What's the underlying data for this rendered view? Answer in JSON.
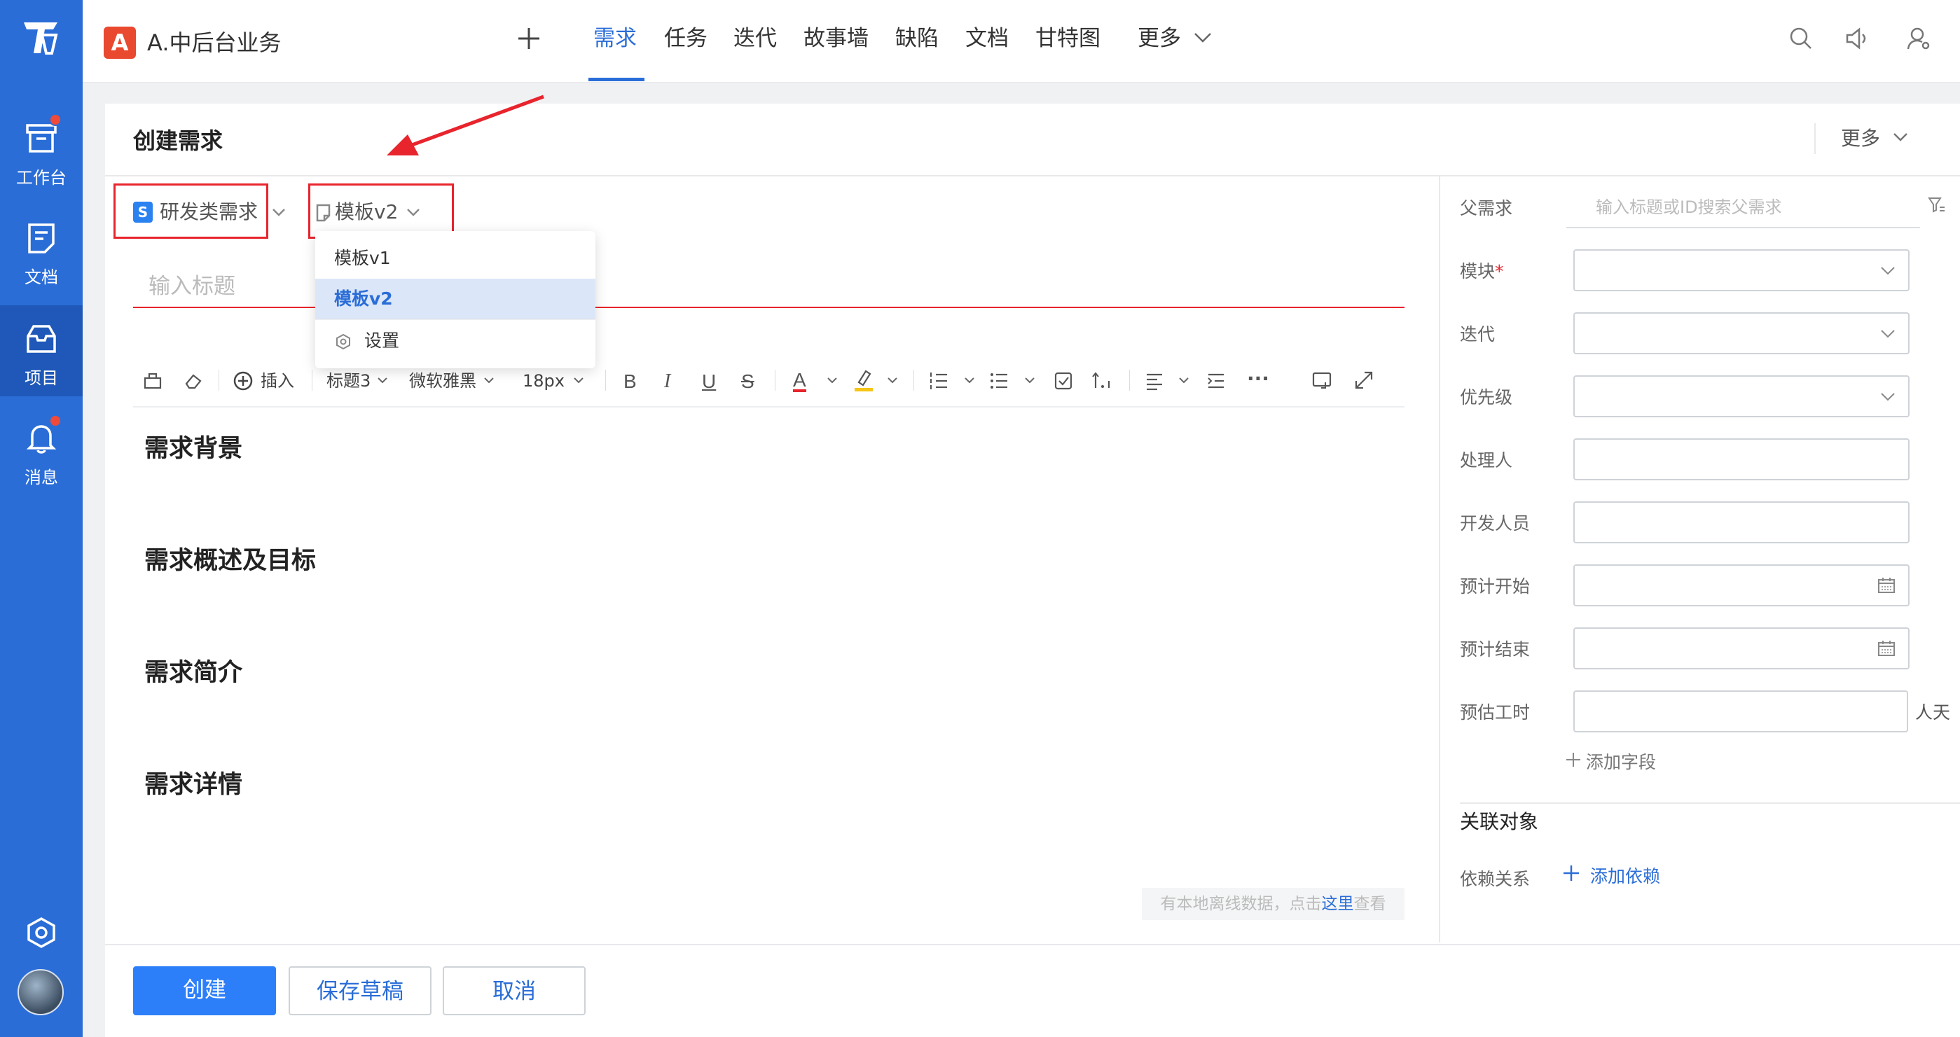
{
  "sidebar": {
    "items": [
      {
        "label": "工作台",
        "icon": "workbench-icon",
        "badge": true
      },
      {
        "label": "文档",
        "icon": "document-icon",
        "badge": false
      },
      {
        "label": "项目",
        "icon": "project-icon",
        "badge": false,
        "active": true
      },
      {
        "label": "消息",
        "icon": "bell-icon",
        "badge": true
      }
    ],
    "bottom_icons": [
      "settings-icon",
      "avatar"
    ]
  },
  "topbar": {
    "project_badge": "A",
    "project_name": "A.中后台业务",
    "add_icon": "plus-icon",
    "tabs": [
      {
        "label": "需求",
        "active": true
      },
      {
        "label": "任务"
      },
      {
        "label": "迭代"
      },
      {
        "label": "故事墙"
      },
      {
        "label": "缺陷"
      },
      {
        "label": "文档"
      },
      {
        "label": "甘特图"
      },
      {
        "label": "更多"
      }
    ],
    "right_icons": [
      "search-icon",
      "speaker-icon",
      "user-settings-icon"
    ]
  },
  "page": {
    "title": "创建需求",
    "more_label": "更多"
  },
  "editor": {
    "type_badge": "S",
    "type_label": "研发类需求",
    "template_label": "模板v2",
    "template_dropdown": {
      "options": [
        {
          "label": "模板v1",
          "selected": false
        },
        {
          "label": "模板v2",
          "selected": true
        },
        {
          "label": "设置",
          "icon": "gear-icon"
        }
      ]
    },
    "title_placeholder": "输入标题",
    "toolbar": {
      "insert_label": "插入",
      "heading_label": "标题3",
      "font_label": "微软雅黑",
      "size_label": "18px"
    },
    "sections": [
      "需求背景",
      "需求概述及目标",
      "需求简介",
      "需求详情"
    ],
    "offline_notice": {
      "prefix": "有本地离线数据，点击",
      "link": "这里",
      "suffix": "查看"
    }
  },
  "right_panel": {
    "parent_label": "父需求",
    "parent_placeholder": "输入标题或ID搜索父需求",
    "fields": [
      {
        "label": "模块",
        "required": true,
        "kind": "select"
      },
      {
        "label": "迭代",
        "kind": "select"
      },
      {
        "label": "优先级",
        "kind": "select"
      },
      {
        "label": "处理人",
        "kind": "text"
      },
      {
        "label": "开发人员",
        "kind": "text"
      },
      {
        "label": "预计开始",
        "kind": "date"
      },
      {
        "label": "预计结束",
        "kind": "date"
      },
      {
        "label": "预估工时",
        "kind": "text",
        "unit": "人天"
      }
    ],
    "add_field_label": "添加字段",
    "related_title": "关联对象",
    "dependency_label": "依赖关系",
    "add_dependency_label": "添加依赖"
  },
  "footer": {
    "create_label": "创建",
    "save_draft_label": "保存草稿",
    "cancel_label": "取消"
  },
  "colors": {
    "brand": "#2a6dd7",
    "primary_button": "#2d7ff9",
    "highlight_box": "#e8242d",
    "badge_dot": "#f04a3a"
  }
}
